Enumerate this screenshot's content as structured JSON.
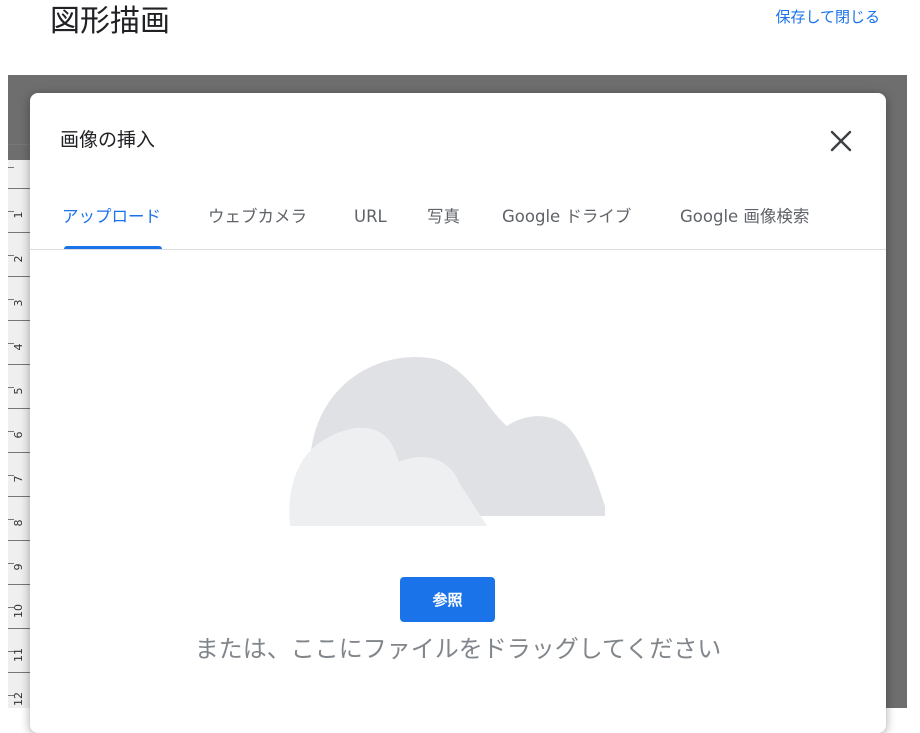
{
  "header": {
    "title": "図形描画",
    "save_close_label": "保存して閉じる"
  },
  "ruler": {
    "numbers": [
      "1",
      "2",
      "3",
      "4",
      "5",
      "6",
      "7",
      "8",
      "9",
      "10",
      "11",
      "12"
    ]
  },
  "dialog": {
    "title": "画像の挿入",
    "tabs": [
      {
        "label": "アップロード",
        "active": true
      },
      {
        "label": "ウェブカメラ",
        "active": false
      },
      {
        "label": "URL",
        "active": false
      },
      {
        "label": "写真",
        "active": false
      },
      {
        "label": "Google ドライブ",
        "active": false
      },
      {
        "label": "Google 画像検索",
        "active": false
      }
    ],
    "browse_label": "参照",
    "drag_text": "または、ここにファイルをドラッグしてください",
    "close_icon": "close-icon",
    "illustration_icon": "cloud-illustration"
  },
  "colors": {
    "accent": "#1a73e8",
    "backdrop": "#6e6e6e",
    "cloud_back": "#e0e1e4",
    "cloud_front": "#eeeff1"
  }
}
